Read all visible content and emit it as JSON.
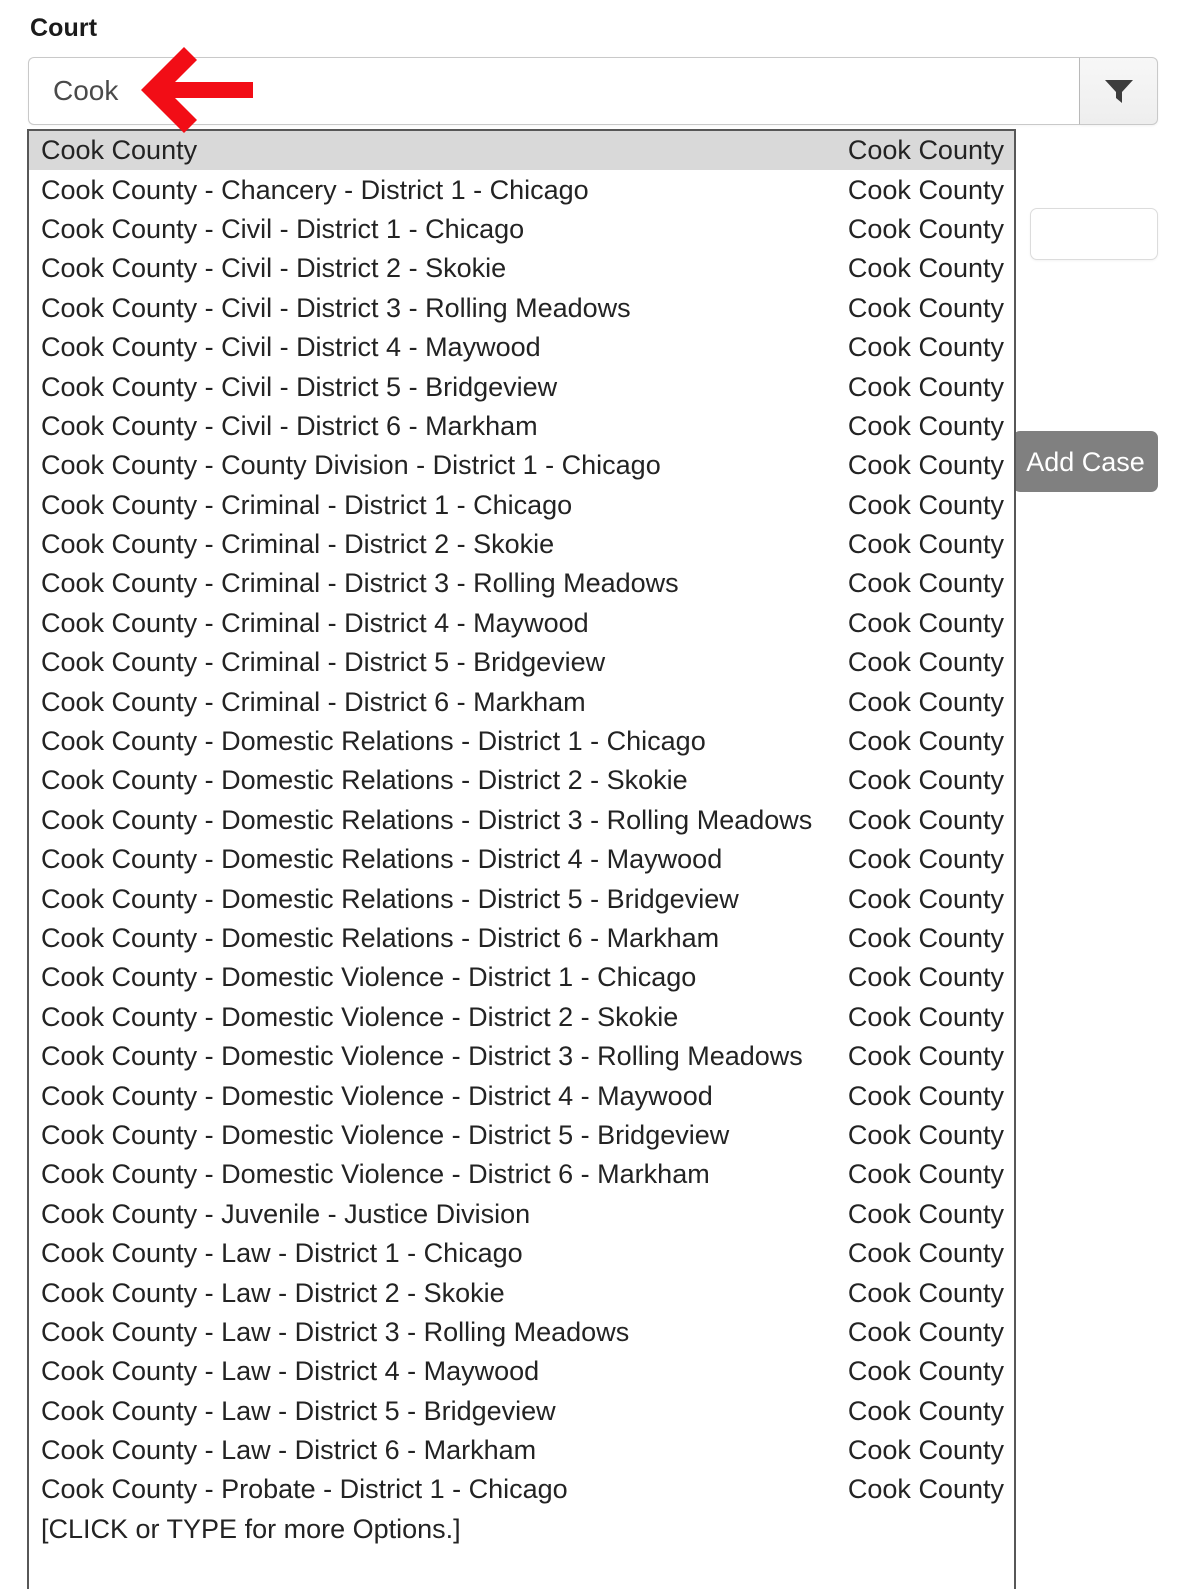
{
  "form": {
    "label": "Court"
  },
  "search": {
    "value": "Cook",
    "placeholder": "Court",
    "filter_icon": "filter-funnel-icon"
  },
  "side_field": {
    "value": "",
    "placeholder": ""
  },
  "actions": {
    "add_case_label": "Add Case"
  },
  "annotation": {
    "arrow": "left-arrow-annotation",
    "color": "#f20d16"
  },
  "colors": {
    "selected_row_bg": "#d9d9d9",
    "dropdown_border": "#575757",
    "button_bg": "#808080",
    "annotation_red": "#f20d16"
  },
  "dropdown": {
    "selected_index": 0,
    "hint": "[CLICK or TYPE for more Options.]",
    "items": [
      {
        "label": "Cook County",
        "county": "Cook County"
      },
      {
        "label": "Cook County - Chancery - District 1 - Chicago",
        "county": "Cook County"
      },
      {
        "label": "Cook County - Civil - District 1 - Chicago",
        "county": "Cook County"
      },
      {
        "label": "Cook County - Civil - District 2 - Skokie",
        "county": "Cook County"
      },
      {
        "label": "Cook County - Civil - District 3 - Rolling Meadows",
        "county": "Cook County"
      },
      {
        "label": "Cook County - Civil - District 4 - Maywood",
        "county": "Cook County"
      },
      {
        "label": "Cook County - Civil - District 5 - Bridgeview",
        "county": "Cook County"
      },
      {
        "label": "Cook County - Civil - District 6 - Markham",
        "county": "Cook County"
      },
      {
        "label": "Cook County - County Division - District 1 - Chicago",
        "county": "Cook County"
      },
      {
        "label": "Cook County - Criminal - District 1 - Chicago",
        "county": "Cook County"
      },
      {
        "label": "Cook County - Criminal - District 2 - Skokie",
        "county": "Cook County"
      },
      {
        "label": "Cook County - Criminal - District 3 - Rolling Meadows",
        "county": "Cook County"
      },
      {
        "label": "Cook County - Criminal - District 4 - Maywood",
        "county": "Cook County"
      },
      {
        "label": "Cook County - Criminal - District 5 - Bridgeview",
        "county": "Cook County"
      },
      {
        "label": "Cook County - Criminal - District 6 - Markham",
        "county": "Cook County"
      },
      {
        "label": "Cook County - Domestic Relations - District 1 - Chicago",
        "county": "Cook County"
      },
      {
        "label": "Cook County - Domestic Relations - District 2 - Skokie",
        "county": "Cook County"
      },
      {
        "label": "Cook County - Domestic Relations - District 3 - Rolling Meadows",
        "county": "Cook County"
      },
      {
        "label": "Cook County - Domestic Relations - District 4 - Maywood",
        "county": "Cook County"
      },
      {
        "label": "Cook County - Domestic Relations - District 5 - Bridgeview",
        "county": "Cook County"
      },
      {
        "label": "Cook County - Domestic Relations - District 6 - Markham",
        "county": "Cook County"
      },
      {
        "label": "Cook County - Domestic Violence - District 1 - Chicago",
        "county": "Cook County"
      },
      {
        "label": "Cook County - Domestic Violence - District 2 - Skokie",
        "county": "Cook County"
      },
      {
        "label": "Cook County - Domestic Violence - District 3 - Rolling Meadows",
        "county": "Cook County"
      },
      {
        "label": "Cook County - Domestic Violence - District 4 - Maywood",
        "county": "Cook County"
      },
      {
        "label": "Cook County - Domestic Violence - District 5 - Bridgeview",
        "county": "Cook County"
      },
      {
        "label": "Cook County - Domestic Violence - District 6 - Markham",
        "county": "Cook County"
      },
      {
        "label": "Cook County - Juvenile - Justice Division",
        "county": "Cook County"
      },
      {
        "label": "Cook County - Law - District 1 - Chicago",
        "county": "Cook County"
      },
      {
        "label": "Cook County - Law - District 2 - Skokie",
        "county": "Cook County"
      },
      {
        "label": "Cook County - Law - District 3 - Rolling Meadows",
        "county": "Cook County"
      },
      {
        "label": "Cook County - Law - District 4 - Maywood",
        "county": "Cook County"
      },
      {
        "label": "Cook County - Law - District 5 - Bridgeview",
        "county": "Cook County"
      },
      {
        "label": "Cook County - Law - District 6 - Markham",
        "county": "Cook County"
      },
      {
        "label": "Cook County - Probate - District 1 - Chicago",
        "county": "Cook County"
      }
    ]
  }
}
